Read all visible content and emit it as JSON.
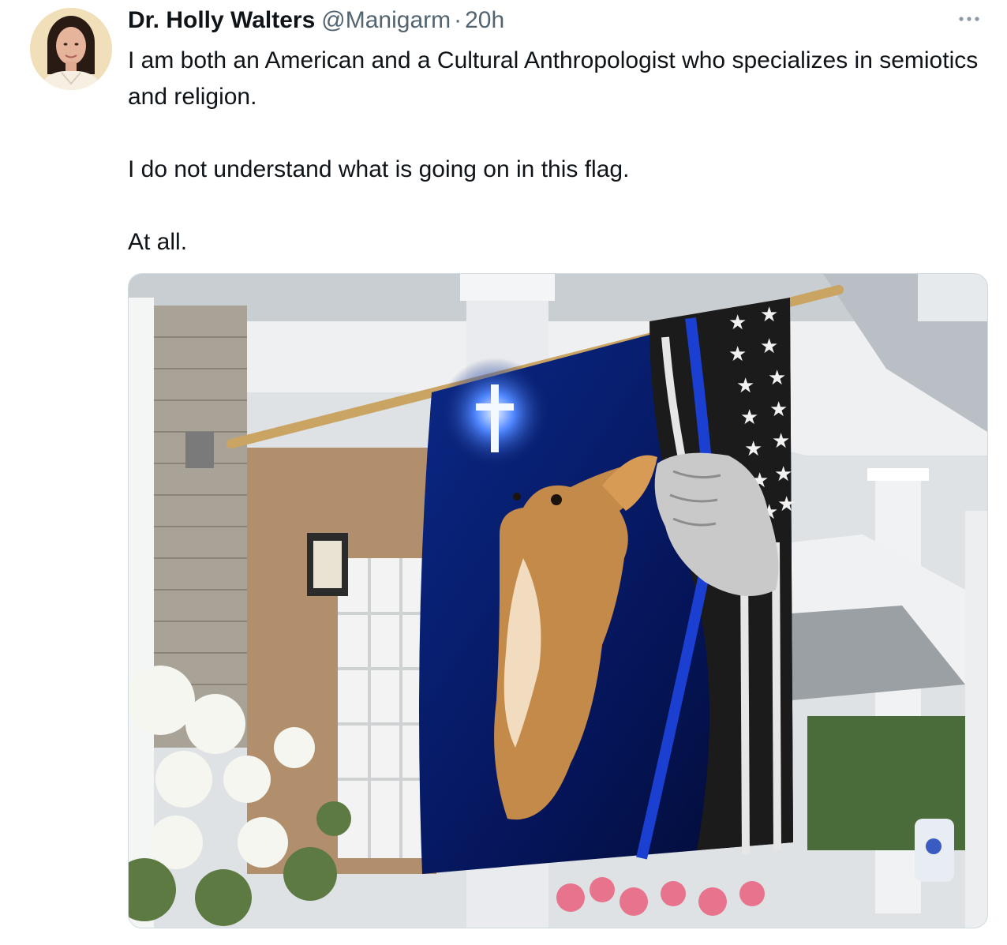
{
  "author": {
    "display_name": "Dr. Holly Walters",
    "handle": "@Manigarm",
    "separator": "·",
    "timestamp": "20h",
    "avatar_icon": "profile-photo"
  },
  "more_icon": "more-horizontal-icon",
  "tweet": {
    "paragraphs": [
      "I am both an American and a Cultural Anthropologist who specializes in semiotics and religion.",
      "I do not understand what is going on in this flag.",
      "At all."
    ]
  },
  "media": {
    "type": "photo",
    "description_icon": "flag-photo"
  },
  "colors": {
    "text_primary": "#0f1419",
    "text_secondary": "#536471",
    "border": "#cfd9de",
    "thin_blue_line": "#1a3fd1"
  }
}
